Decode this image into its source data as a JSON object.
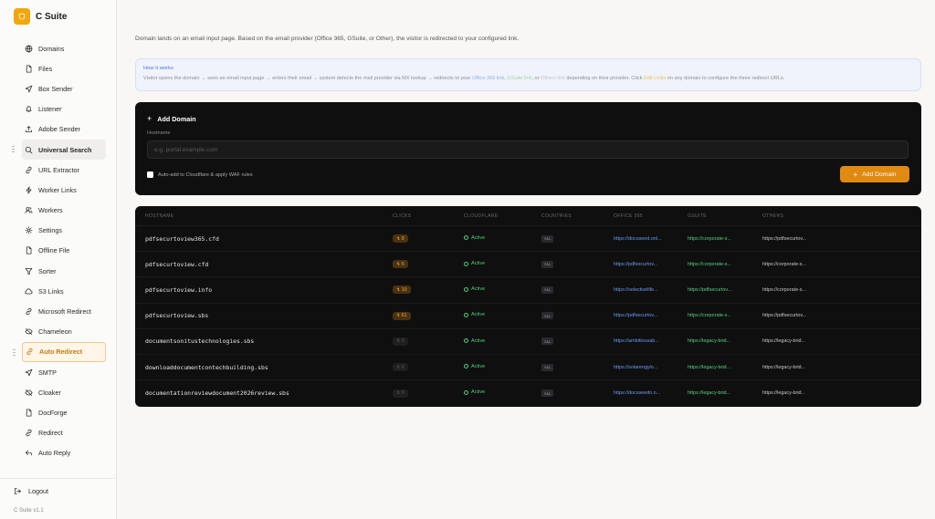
{
  "app": {
    "title": "C Suite",
    "version": "C Suite v1.1"
  },
  "sidebar": {
    "items": [
      {
        "label": "Domains",
        "icon": "globe-icon",
        "state": ""
      },
      {
        "label": "Files",
        "icon": "file-icon",
        "state": ""
      },
      {
        "label": "Box Sender",
        "icon": "send-icon",
        "state": ""
      },
      {
        "label": "Listener",
        "icon": "bell-icon",
        "state": ""
      },
      {
        "label": "Adobe Sender",
        "icon": "upload-icon",
        "state": ""
      },
      {
        "label": "Universal Search",
        "icon": "search-icon",
        "state": "hover"
      },
      {
        "label": "URL Extractor",
        "icon": "link-icon",
        "state": ""
      },
      {
        "label": "Worker Links",
        "icon": "bolt-icon",
        "state": ""
      },
      {
        "label": "Workers",
        "icon": "users-icon",
        "state": ""
      },
      {
        "label": "Settings",
        "icon": "gear-icon",
        "state": ""
      },
      {
        "label": "Offline File",
        "icon": "file-icon",
        "state": ""
      },
      {
        "label": "Sorter",
        "icon": "filter-icon",
        "state": ""
      },
      {
        "label": "S3 Links",
        "icon": "cloud-icon",
        "state": ""
      },
      {
        "label": "Microsoft Redirect",
        "icon": "link-icon",
        "state": ""
      },
      {
        "label": "Chameleon",
        "icon": "eye-off-icon",
        "state": ""
      },
      {
        "label": "Auto Redirect",
        "icon": "link-icon",
        "state": "active"
      },
      {
        "label": "SMTP",
        "icon": "send-icon",
        "state": ""
      },
      {
        "label": "Cloaker",
        "icon": "eye-off-icon",
        "state": ""
      },
      {
        "label": "DocForge",
        "icon": "file-icon",
        "state": ""
      },
      {
        "label": "Redirect",
        "icon": "link-icon",
        "state": ""
      },
      {
        "label": "Auto Reply",
        "icon": "reply-icon",
        "state": ""
      }
    ],
    "logout": "Logout"
  },
  "main": {
    "description": "Domain lands on an email input page. Based on the email provider (Office 365, GSuite, or Other), the visitor is redirected to your configured link.",
    "info": {
      "title": "How it works",
      "part1": "Visitor opens the domain → sees an email input page → enters their email → system detects the mail provider via MX lookup → redirects to your ",
      "o365": "Office 365 link",
      "sep1": ", ",
      "gsuite": "GSuite link",
      "sep2": ", or ",
      "others": "Others link",
      "part2": " depending on their provider. Click ",
      "edit": "Edit Links",
      "part3": " on any domain to configure the three redirect URLs."
    },
    "add": {
      "title": "Add Domain",
      "hostname_label": "Hostname",
      "hostname_placeholder": "e.g. portal.example.com",
      "hostname_value": "",
      "cloudflare_label": "Auto-add to Cloudflare & apply WAF rules",
      "cloudflare_checked": false,
      "button": "Add Domain"
    },
    "table": {
      "headers": [
        "HOSTNAME",
        "CLICKS",
        "CLOUDFLARE",
        "COUNTRIES",
        "OFFICE 365",
        "GSUITE",
        "OTHERS"
      ],
      "rows": [
        {
          "hostname": "pdfsecurtoview365.cfd",
          "clicks": "9",
          "cloudflare": "Active",
          "countries": "ALL",
          "o365": "https://docsseed.onl...",
          "gsuite": "https://corporate-s...",
          "others": "https://pdfsecurtov..."
        },
        {
          "hostname": "pdfsecurtoview.cfd",
          "clicks": "5",
          "cloudflare": "Active",
          "countries": "ALL",
          "o365": "https://pdfsecurtov...",
          "gsuite": "https://corporate-s...",
          "others": "https://corporate-s..."
        },
        {
          "hostname": "pdfsecurtoview.info",
          "clicks": "10",
          "cloudflare": "Active",
          "countries": "ALL",
          "o365": "https://selectivelife...",
          "gsuite": "https://pdfsecurtov...",
          "others": "https://corporate-s..."
        },
        {
          "hostname": "pdfsecurtoview.sbs",
          "clicks": "61",
          "cloudflare": "Active",
          "countries": "ALL",
          "o365": "https://pdfsecurtov...",
          "gsuite": "https://corporate-s...",
          "others": "https://pdfsecurtov..."
        },
        {
          "hostname": "documentsonitustechnologies.sbs",
          "clicks": "0",
          "cloudflare": "Active",
          "countries": "ALL",
          "o365": "https://ambitiousab...",
          "gsuite": "https://legacy-brid...",
          "others": "https://legacy-brid..."
        },
        {
          "hostname": "downloaddocumentcontechbuilding.sbs",
          "clicks": "0",
          "cloudflare": "Active",
          "countries": "ALL",
          "o365": "https://solarengylo...",
          "gsuite": "https://legacy-brid...",
          "others": "https://legacy-brid..."
        },
        {
          "hostname": "documentationreviewdocument2026review.sbs",
          "clicks": "0",
          "cloudflare": "Active",
          "countries": "ALL",
          "o365": "https://docsseedn.o...",
          "gsuite": "https://legacy-brid...",
          "others": "https://legacy-brid..."
        }
      ]
    }
  },
  "colors": {
    "accent": "#e08a12",
    "active_text": "#c8780a",
    "status_active": "#4ed07a",
    "link_blue": "#6a9cf0",
    "link_green": "#5ad07e"
  }
}
